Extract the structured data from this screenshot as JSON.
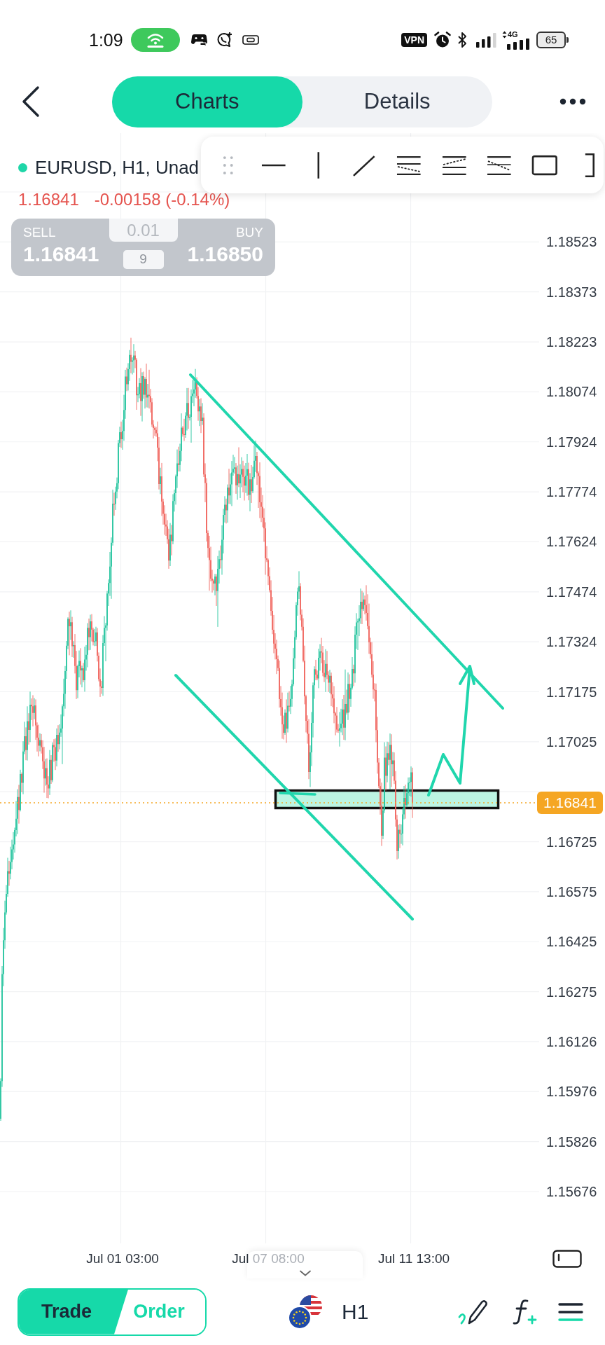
{
  "status_bar": {
    "time": "1:09",
    "vpn": "VPN",
    "network": "4G",
    "battery": "65"
  },
  "header": {
    "tabs": [
      {
        "label": "Charts",
        "selected": true
      },
      {
        "label": "Details",
        "selected": false
      }
    ]
  },
  "symbol": {
    "title": "EURUSD, H1, Unad",
    "price": "1.16841",
    "change": "-0.00158 (-0.14%)"
  },
  "quote_panel": {
    "sell": {
      "label": "SELL",
      "price": "1.16841"
    },
    "lot": "0.01",
    "spread": "9",
    "buy": {
      "label": "BUY",
      "price": "1.16850"
    }
  },
  "chart": {
    "price_labels": [
      "1.18523",
      "1.18373",
      "1.18223",
      "1.18074",
      "1.17924",
      "1.17774",
      "1.17624",
      "1.17474",
      "1.17324",
      "1.17175",
      "1.17025",
      "1.16725",
      "1.16575",
      "1.16425",
      "1.16275",
      "1.16126",
      "1.15976",
      "1.15826",
      "1.15676"
    ],
    "current_price": "1.16841",
    "time_labels": [
      "Jul 01 03:00",
      "Jul 07 08:00",
      "Jul 11 13:00"
    ]
  },
  "bottom_bar": {
    "modes": [
      {
        "label": "Trade",
        "selected": true
      },
      {
        "label": "Order",
        "selected": false
      }
    ],
    "timeframe": "H1"
  }
}
